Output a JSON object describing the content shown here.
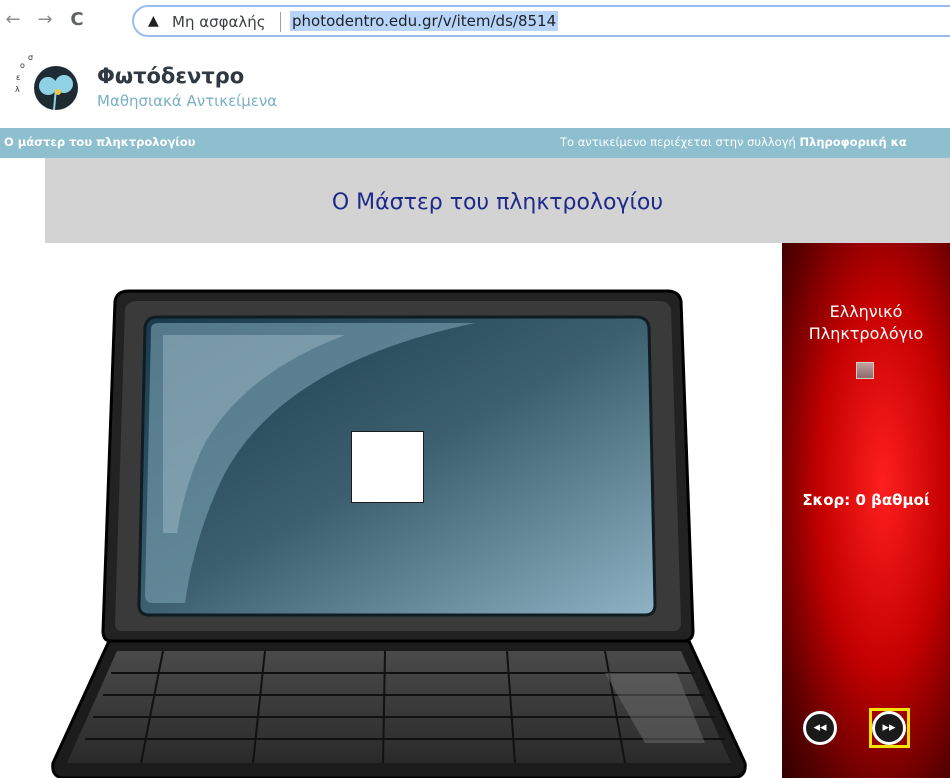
{
  "browser": {
    "back_glyph": "←",
    "forward_glyph": "→",
    "reload_glyph": "C",
    "security_label": "Μη ασφαλής",
    "url": "photodentro.edu.gr/v/item/ds/8514"
  },
  "site": {
    "name": "Φωτόδεντρο",
    "subtitle": "Μαθησιακά Αντικείμενα"
  },
  "info_bar": {
    "item_title": "Ο μάστερ του πληκτρολογίου",
    "collection_text": "Το αντικείμενο περιέχεται στην συλλογή ",
    "collection_name": "Πληροφορική κα"
  },
  "activity": {
    "title": "Ο Μάστερ του πληκτρολογίου",
    "keyboard_label": "Ελληνικό Πληκτρολόγιο",
    "score_text": "Σκορ: 0 βαθμοί",
    "prev_glyph": "◂◂",
    "next_glyph": "▸▸"
  },
  "colors": {
    "info_bar": "#8ebfcf",
    "title_panel": "#d3d3d3",
    "title_text": "#1e2a8a",
    "side_panel": "#c30000",
    "next_highlight": "#f2e300"
  }
}
